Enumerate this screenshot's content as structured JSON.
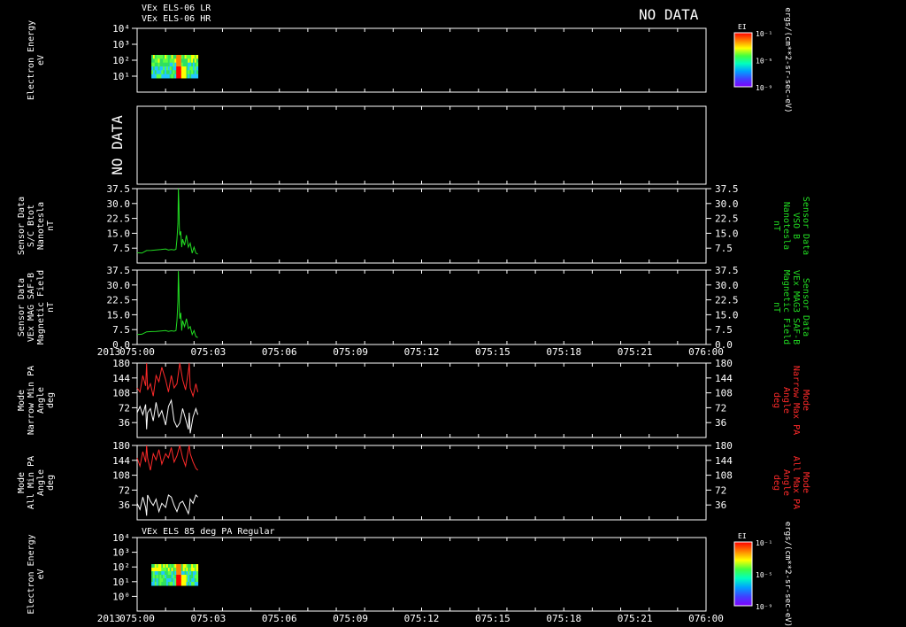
{
  "header": {
    "line1": "VEx ELS-06 LR",
    "line2": "VEx ELS-06 HR",
    "no_data": "NO DATA",
    "colorbar_label": "EI",
    "colorbar_unit": "ergs/(cm**2-sr-sec-eV)"
  },
  "colors": {
    "background": "#000000",
    "axis": "#ffffff",
    "green": "#22dd22",
    "red": "#ff2a2a",
    "white": "#ffffff"
  },
  "chart_data": [
    {
      "type": "heatmap",
      "id": "spec1",
      "ylabel": [
        "Electron Energy",
        "eV"
      ],
      "yticks": [
        "10¹",
        "10²",
        "10³",
        "10⁴"
      ],
      "ylog": true,
      "xrange_min": [
        0,
        60
      ],
      "data_extent_min": [
        0,
        6.4
      ],
      "colorbar": {
        "label": "EI",
        "ticks": [
          "10⁻¹",
          "10⁻⁵",
          "10⁻⁹"
        ]
      }
    },
    {
      "type": "empty",
      "id": "nodata",
      "label": "NO DATA"
    },
    {
      "type": "line",
      "id": "bmag1",
      "ylabel": [
        "Sensor Data",
        "S/C Btot",
        "Nanotesla",
        "nT"
      ],
      "ylabel_right": [
        "Sensor Data",
        "VSO B",
        "Nanotesla",
        "nT"
      ],
      "yticks": [
        "37.5",
        "30.0",
        "22.5",
        "15.0",
        "7.5"
      ],
      "ylim": [
        0,
        37.5
      ],
      "series": [
        {
          "color": "green",
          "x": [
            0,
            0.5,
            1,
            1.5,
            2,
            2.5,
            3,
            3.3,
            3.6,
            3.9,
            4.1,
            4.2,
            4.3,
            4.35,
            4.4,
            4.45,
            4.5,
            4.6,
            4.7,
            4.8,
            5,
            5.2,
            5.4,
            5.6,
            5.8,
            6.0,
            6.2,
            6.4
          ],
          "y": [
            5.2,
            5.0,
            6.3,
            6.4,
            6.6,
            6.8,
            7.1,
            6.5,
            6.8,
            6.6,
            6.9,
            12,
            20,
            37.5,
            30,
            18,
            14,
            16,
            8,
            12,
            9,
            14,
            8,
            10,
            5,
            8,
            5,
            4.5
          ]
        }
      ]
    },
    {
      "type": "line",
      "id": "bmag2",
      "ylabel": [
        "Sensor Data",
        "VEx MAG SAF-B",
        "Magnetic Field",
        "nT"
      ],
      "ylabel_right": [
        "Sensor Data",
        "VEx MAG3 SAF-B",
        "Magnetic Field",
        "nT"
      ],
      "yticks": [
        "37.5",
        "30.0",
        "22.5",
        "15.0",
        "7.5",
        "0.0"
      ],
      "ylim": [
        0,
        37.5
      ],
      "series": [
        {
          "color": "green",
          "x": [
            0,
            0.5,
            1,
            1.5,
            2,
            2.5,
            3,
            3.3,
            3.6,
            3.9,
            4.1,
            4.2,
            4.3,
            4.35,
            4.4,
            4.45,
            4.5,
            4.6,
            4.7,
            4.8,
            5,
            5.2,
            5.4,
            5.6,
            5.8,
            6.0,
            6.2,
            6.4
          ],
          "y": [
            5.0,
            5.2,
            6.4,
            6.5,
            6.6,
            6.8,
            7.0,
            6.6,
            6.9,
            6.7,
            7.0,
            12,
            22,
            37.0,
            29,
            17,
            13,
            16,
            7,
            12,
            9,
            13,
            8,
            9,
            5,
            7,
            4,
            3.5
          ]
        }
      ]
    },
    {
      "type": "line",
      "id": "pa_narrow",
      "ylabel": [
        "Mode",
        "Narrow Min PA",
        "Angle",
        "deg"
      ],
      "ylabel_right": [
        "Mode",
        "Narrow Max PA",
        "Angle",
        "deg"
      ],
      "yticks": [
        "180",
        "144",
        "108",
        "72",
        "36"
      ],
      "ylim": [
        0,
        180
      ],
      "series": [
        {
          "color": "red",
          "x": [
            0,
            0.3,
            0.6,
            0.9,
            1.0,
            1.1,
            1.4,
            1.7,
            2.0,
            2.3,
            2.6,
            3.0,
            3.3,
            3.6,
            3.9,
            4.2,
            4.5,
            4.8,
            5.1,
            5.4,
            5.5,
            5.6,
            5.9,
            6.2,
            6.4
          ],
          "y": [
            120,
            110,
            150,
            125,
            180,
            115,
            130,
            100,
            150,
            135,
            170,
            140,
            110,
            150,
            120,
            130,
            180,
            140,
            115,
            160,
            180,
            120,
            100,
            130,
            110
          ]
        },
        {
          "color": "white",
          "x": [
            0,
            0.3,
            0.6,
            0.9,
            1.0,
            1.1,
            1.4,
            1.7,
            2.0,
            2.3,
            2.6,
            3.0,
            3.3,
            3.6,
            3.9,
            4.2,
            4.5,
            4.8,
            5.1,
            5.4,
            5.5,
            5.6,
            5.9,
            6.2,
            6.4
          ],
          "y": [
            60,
            75,
            55,
            80,
            20,
            60,
            70,
            40,
            85,
            50,
            65,
            30,
            75,
            90,
            40,
            25,
            35,
            70,
            45,
            20,
            60,
            10,
            50,
            70,
            55
          ]
        }
      ]
    },
    {
      "type": "line",
      "id": "pa_all",
      "ylabel": [
        "Mode",
        "All Min PA",
        "Angle",
        "deg"
      ],
      "ylabel_right": [
        "Mode",
        "All Max PA",
        "Angle",
        "deg"
      ],
      "yticks": [
        "180",
        "144",
        "108",
        "72",
        "36"
      ],
      "ylim": [
        0,
        180
      ],
      "series": [
        {
          "color": "red",
          "x": [
            0,
            0.3,
            0.6,
            0.9,
            1.0,
            1.1,
            1.4,
            1.7,
            2.0,
            2.3,
            2.6,
            3.0,
            3.3,
            3.6,
            3.9,
            4.2,
            4.5,
            4.8,
            5.1,
            5.4,
            5.5,
            5.6,
            5.9,
            6.2,
            6.4
          ],
          "y": [
            150,
            130,
            165,
            140,
            180,
            150,
            120,
            160,
            145,
            170,
            135,
            160,
            150,
            175,
            140,
            155,
            180,
            150,
            130,
            170,
            180,
            160,
            140,
            125,
            120
          ]
        },
        {
          "color": "white",
          "x": [
            0,
            0.3,
            0.6,
            0.9,
            1.0,
            1.1,
            1.4,
            1.7,
            2.0,
            2.3,
            2.6,
            3.0,
            3.3,
            3.6,
            3.9,
            4.2,
            4.5,
            4.8,
            5.1,
            5.4,
            5.5,
            5.6,
            5.9,
            6.2,
            6.4
          ],
          "y": [
            40,
            25,
            55,
            30,
            10,
            60,
            45,
            35,
            50,
            20,
            40,
            30,
            60,
            55,
            35,
            20,
            40,
            45,
            30,
            15,
            25,
            50,
            40,
            60,
            55
          ]
        }
      ]
    },
    {
      "type": "heatmap",
      "id": "spec2",
      "title": "VEx ELS 85 deg PA Regular",
      "ylabel": [
        "Electron Energy",
        "eV"
      ],
      "yticks": [
        "10⁰",
        "10¹",
        "10²",
        "10³",
        "10⁴"
      ],
      "ylog": true,
      "xrange_min": [
        0,
        60
      ],
      "data_extent_min": [
        0,
        6.4
      ],
      "colorbar": {
        "label": "EI",
        "ticks": [
          "10⁻¹",
          "10⁻⁵",
          "10⁻⁹"
        ]
      }
    }
  ],
  "xaxis": {
    "labels": [
      "075:00",
      "075:03",
      "075:06",
      "075:09",
      "075:12",
      "075:15",
      "075:18",
      "075:21",
      "076:00"
    ],
    "year": "2013"
  }
}
